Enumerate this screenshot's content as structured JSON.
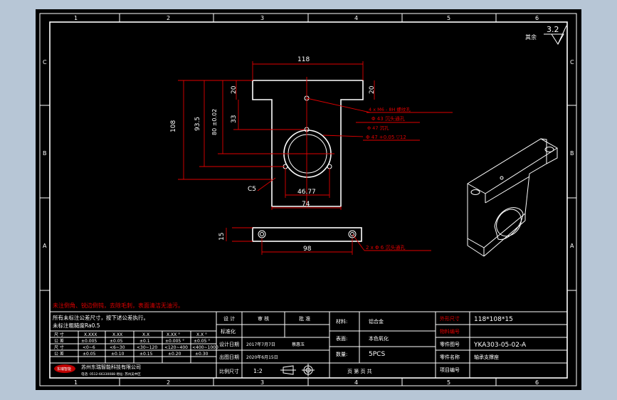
{
  "drawing": {
    "surface_roughness": "3.2",
    "roughness_note": "其余",
    "zone_numbers_top": [
      "1",
      "2",
      "3",
      "4",
      "5",
      "6"
    ],
    "zone_numbers_bottom": [
      "1",
      "2",
      "3",
      "4",
      "5",
      "6"
    ],
    "zone_letters_left": [
      "A",
      "B",
      "C"
    ],
    "zone_letters_right": [
      "A",
      "B",
      "C"
    ]
  },
  "dimensions": {
    "top_width": "118",
    "left_flange_h": "20",
    "right_flange_h": "20",
    "height_total": "108",
    "height_93": "93.5",
    "height_80": "80 ±0.02",
    "height_33": "33",
    "bottom_inner": "46.77",
    "bottom_width": "74",
    "chamfer": "C5",
    "side_thickness": "15",
    "hole_spacing": "98"
  },
  "annotations": {
    "tap_holes": "4 x M6 - 8H 螺纹孔",
    "phi43": "Φ 43 沉头通孔",
    "phi47": "Φ 47 +0.05 ▽12",
    "phi47_hole": "Φ 47 沉孔",
    "side_holes": "2 x Φ 6 沉头通孔"
  },
  "notes": {
    "red_note": "未注倒角、锐边倒钝，去除毛刺，表面清洁无油污。",
    "general": "所有未标注公差尺寸，按下述公差执行。",
    "roughness_default": "未标注粗糙度Ra0.5"
  },
  "tolerance_table": {
    "headers": [
      "尺  寸",
      "X.XXX",
      "X.XX",
      "X.X",
      "X.XX °",
      "X.X °"
    ],
    "rows": [
      [
        "公  差",
        "±0.005",
        "±0.05",
        "±0.1",
        "±0.005 °",
        "±0.05 °"
      ],
      [
        "尺  寸",
        "<0~6",
        "<6~30",
        "<30~120",
        "<120~400",
        "<400~1000"
      ],
      [
        "公  差",
        "±0.05",
        "±0.10",
        "±0.15",
        "±0.20",
        "±0.30"
      ]
    ]
  },
  "signatures": {
    "labels": [
      "设 计",
      "审 核",
      "批 准"
    ],
    "row2_label": "标准化",
    "design_date_label": "设计日期",
    "design_date_value": "2017年7月7日",
    "design_person": "蔡惠玉",
    "fill_date_label": "出图日期",
    "fill_date_value": "2020年6月15日",
    "scale_label": "比例尺寸",
    "scale_value": "1:2"
  },
  "part_info": {
    "material_label": "材料:",
    "material_value": "铝合金",
    "surface_label": "表面:",
    "surface_value": "本色氧化",
    "qty_label": "数量:",
    "qty_value": "5PCS",
    "page_label": "页 第 页 共",
    "size_label": "外形尺寸",
    "size_value": "118*108*15",
    "mat_no_label": "物料编号",
    "mat_no_value": "",
    "drawing_no_label": "零件图号",
    "drawing_no_value": "YKA303-05-02-A",
    "part_name_label": "零件名称",
    "part_name_value": "轴承支撑座",
    "proj_label": "项目编号",
    "proj_value": ""
  },
  "company": {
    "name": "苏州东瑞智能科技有限公司",
    "address": "电话: 0512-66330088  地址: 苏州吴中区",
    "logo_text": "东瑞智能"
  },
  "colors": {
    "background": "#b7c6d6",
    "sheet": "#000000",
    "line": "#ffffff",
    "dimension": "#e00000",
    "note": "#e00000"
  }
}
